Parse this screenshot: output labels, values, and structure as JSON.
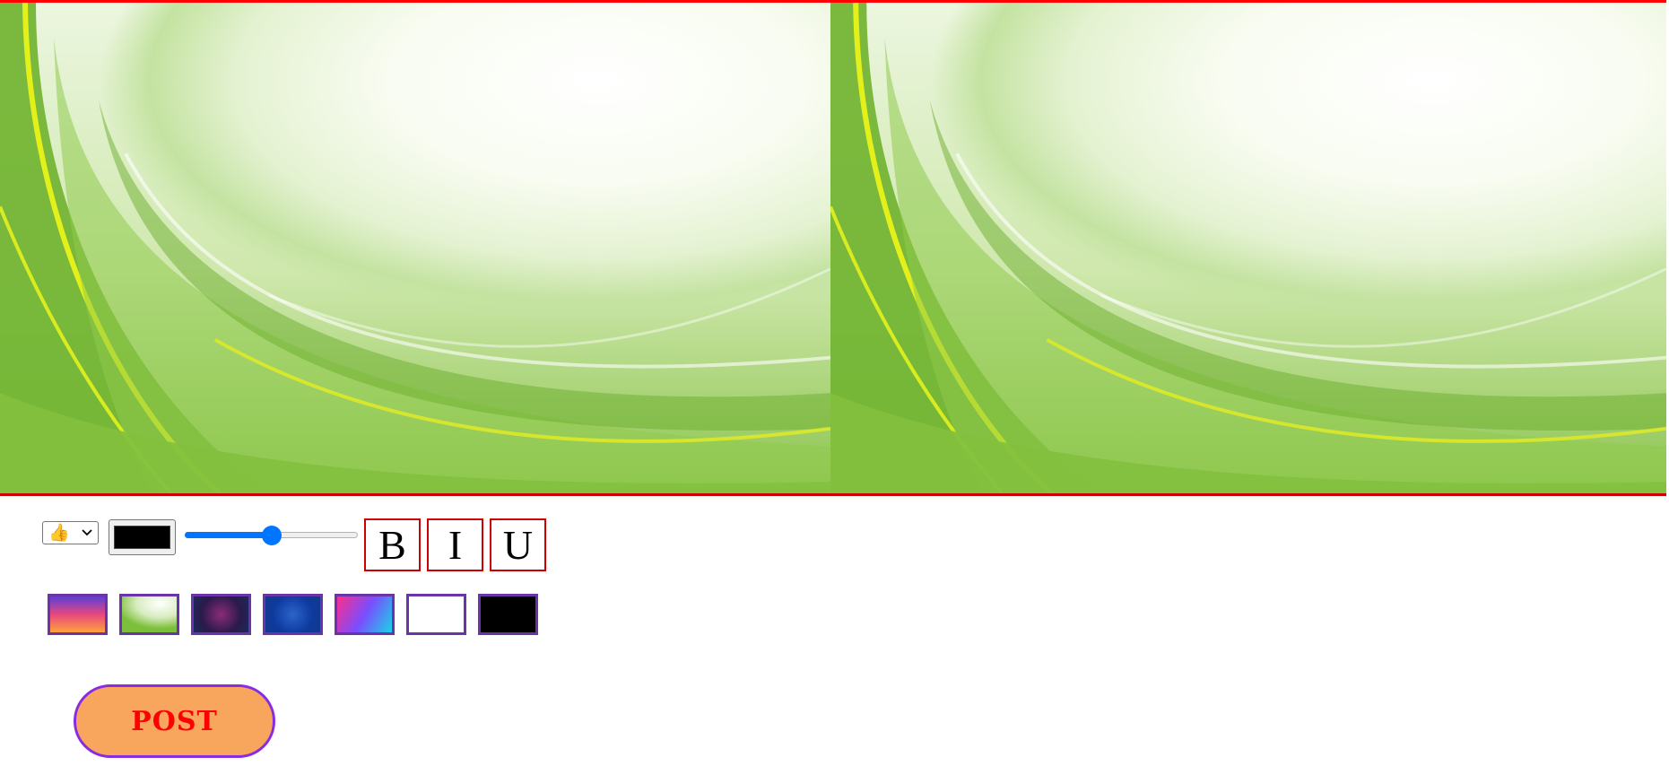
{
  "composer": {
    "text": "",
    "background_name": "green-swirl-background"
  },
  "toolbar": {
    "emoji_select": {
      "value": "👍",
      "icon": "chevron-down-icon"
    },
    "text_color": {
      "value": "#000000"
    },
    "font_size_slider": {
      "fraction": 0.5
    },
    "bold_label": "B",
    "italic_label": "I",
    "underline_label": "U"
  },
  "backgrounds": [
    {
      "name": "sunset-gradient",
      "colors": [
        "#5b3fd8",
        "#e6477d",
        "#ffa23a"
      ]
    },
    {
      "name": "green-swirl",
      "colors": [
        "#ffffff",
        "#d7ecbf",
        "#7cbf3a"
      ]
    },
    {
      "name": "purple-galaxy",
      "colors": [
        "#2a1a4a",
        "#8a2c78",
        "#1b2a5e"
      ]
    },
    {
      "name": "blue-texture",
      "colors": [
        "#0d3a9e",
        "#2d63c9",
        "#133a8a"
      ]
    },
    {
      "name": "rainbow-gradient",
      "colors": [
        "#ff2d8a",
        "#7a4dff",
        "#19d4e6"
      ]
    },
    {
      "name": "plain-white",
      "colors": [
        "#ffffff"
      ]
    },
    {
      "name": "plain-black",
      "colors": [
        "#000000"
      ]
    }
  ],
  "post_button": {
    "label": "POST"
  }
}
